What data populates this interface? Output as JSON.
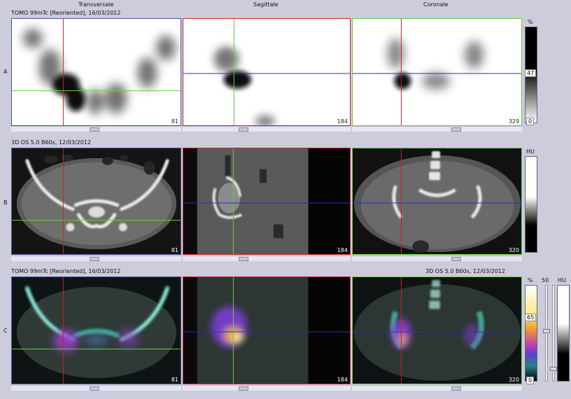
{
  "columns": {
    "transversale": "Transversale",
    "sagittale": "Sagittale",
    "coronale": "Coronale"
  },
  "rows": {
    "a": {
      "letter": "A",
      "series": "TOMO 99mTc [Reoriented], 16/03/2012",
      "slices": [
        "81",
        "184",
        "329"
      ],
      "scale_unit": "%",
      "scale_value": "47",
      "scale_min": "0"
    },
    "b": {
      "letter": "B",
      "series": "3D  OS  5.0  B60s, 12/03/2012",
      "slices": [
        "81",
        "184",
        "320"
      ],
      "scale_unit": "HU"
    },
    "c": {
      "letter": "C",
      "series_left": "TOMO 99mTc [Reoriented], 16/03/2012",
      "series_right": "3D  OS  5.0  B60s, 12/03/2012",
      "slices": [
        "81",
        "184",
        "320"
      ],
      "scale_unit": "%",
      "scale_unit_right": "HU",
      "slider_value": "50",
      "scale_value": "65",
      "scale_min": "0"
    }
  },
  "colors": {
    "background": "#ccccdd",
    "crosshair_red": "#cc2222",
    "crosshair_green": "#66cc44",
    "crosshair_blue": "#2233bb"
  }
}
